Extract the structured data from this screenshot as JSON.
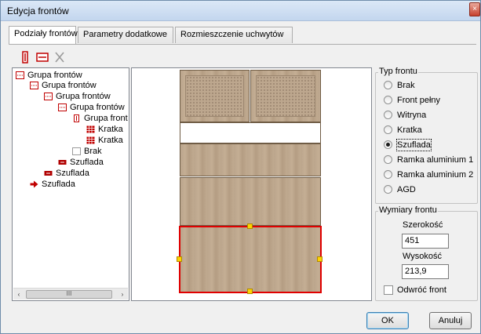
{
  "window": {
    "title": "Edycja frontów",
    "close_glyph": "×"
  },
  "tabs": [
    {
      "label": "Podziały frontów",
      "active": true
    },
    {
      "label": "Parametry dodatkowe",
      "active": false
    },
    {
      "label": "Rozmieszczenie uchwytów",
      "active": false
    }
  ],
  "toolbar": {
    "split_vertical_icon": "split-vertical-icon",
    "split_horizontal_icon": "split-horizontal-icon",
    "delete_icon": "delete-icon"
  },
  "tree": {
    "items": [
      {
        "label": "Grupa frontów",
        "icon": "group-h-icon",
        "level": 0
      },
      {
        "label": "Grupa frontów",
        "icon": "group-h-icon",
        "level": 1
      },
      {
        "label": "Grupa frontów",
        "icon": "group-h-icon",
        "level": 2
      },
      {
        "label": "Grupa frontów",
        "icon": "group-h-icon",
        "level": 3
      },
      {
        "label": "Grupa front",
        "icon": "group-v-icon",
        "level": 4
      },
      {
        "label": "Kratka",
        "icon": "grid-icon",
        "level": 5
      },
      {
        "label": "Kratka",
        "icon": "grid-icon",
        "level": 5
      },
      {
        "label": "Brak",
        "icon": "empty-icon",
        "level": 4
      },
      {
        "label": "Szuflada",
        "icon": "drawer-icon",
        "level": 3
      },
      {
        "label": "Szuflada",
        "icon": "drawer-icon",
        "level": 2
      },
      {
        "label": "Szuflada",
        "icon": "arrow-icon",
        "level": 1,
        "selected": true
      }
    ],
    "scroll_thumb_glyph": "III",
    "scroll_left": "‹",
    "scroll_right": "›"
  },
  "front_type": {
    "title": "Typ frontu",
    "options": [
      "Brak",
      "Front pełny",
      "Witryna",
      "Kratka",
      "Szuflada",
      "Ramka aluminium 1",
      "Ramka aluminium 2",
      "AGD"
    ],
    "selected": "Szuflada"
  },
  "dimensions": {
    "title": "Wymiary frontu",
    "width_label": "Szerokość",
    "width_value": "451",
    "height_label": "Wysokość",
    "height_value": "213,9",
    "flip_label": "Odwróć front",
    "flip_checked": false
  },
  "buttons": {
    "ok": "OK",
    "cancel": "Anuluj"
  },
  "colors": {
    "selection": "#e00000",
    "handle": "#ffd200",
    "wood": "#bba58c"
  }
}
